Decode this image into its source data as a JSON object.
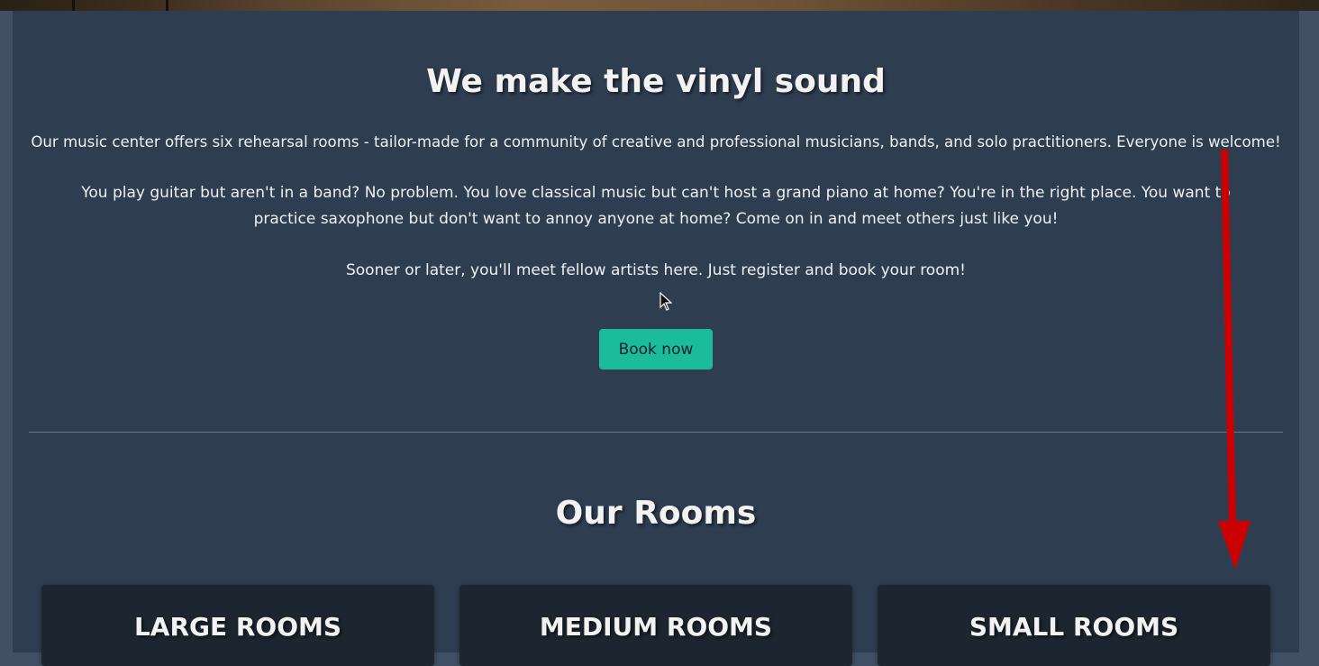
{
  "hero": {
    "title": "We make the vinyl sound"
  },
  "intro": {
    "paragraph_1": "Our music center offers six rehearsal rooms - tailor-made for a community of creative and professional musicians, bands, and solo practitioners. Everyone is welcome!",
    "paragraph_2": "You play guitar but aren't in a band? No problem. You love classical music but can't host a grand piano at home? You're in the right place. You want to practice saxophone but don't want to annoy anyone at home? Come on in and meet others just like you!",
    "paragraph_3": "Sooner or later, you'll meet fellow artists here. Just register and book your room!"
  },
  "cta": {
    "book_label": "Book now",
    "button_color": "#1abc9c"
  },
  "rooms": {
    "title": "Our Rooms",
    "cards": [
      {
        "label": "LARGE ROOMS"
      },
      {
        "label": "MEDIUM ROOMS"
      },
      {
        "label": "SMALL ROOMS"
      }
    ]
  },
  "annotation": {
    "arrow_color": "#cc0000"
  },
  "colors": {
    "page_bg": "#2e3d50",
    "outer_bg": "#415064",
    "card_bg": "#1c2530"
  }
}
